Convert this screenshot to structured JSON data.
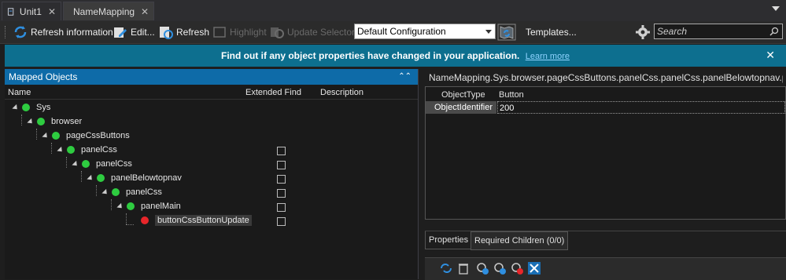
{
  "tabs": [
    {
      "label": "Unit1",
      "icon": "unit-document-icon"
    },
    {
      "label": "NameMapping",
      "icon": "namemapping-icon"
    }
  ],
  "toolbar": {
    "refresh_information": "Refresh information",
    "edit": "Edit...",
    "refresh": "Refresh",
    "highlight": "Highlight",
    "update_selectors": "Update Selectors",
    "configuration": "Default Configuration",
    "templates": "Templates...",
    "search_placeholder": "Search"
  },
  "banner": {
    "message": "Find out if any object properties have changed in your application.",
    "link": "Learn more"
  },
  "left_panel": {
    "title": "Mapped Objects",
    "columns": [
      "Name",
      "Extended Find",
      "Description"
    ],
    "tree": [
      {
        "label": "Sys",
        "status": "green",
        "level": 0
      },
      {
        "label": "browser",
        "status": "green",
        "level": 1
      },
      {
        "label": "pageCssButtons",
        "status": "green",
        "level": 2
      },
      {
        "label": "panelCss",
        "status": "green",
        "level": 3
      },
      {
        "label": "panelCss",
        "status": "green",
        "level": 4
      },
      {
        "label": "panelBelowtopnav",
        "status": "green",
        "level": 5
      },
      {
        "label": "panelCss",
        "status": "green",
        "level": 6
      },
      {
        "label": "panelMain",
        "status": "green",
        "level": 7
      },
      {
        "label": "buttonCssButtonUpdate",
        "status": "red",
        "level": 8
      }
    ]
  },
  "right_panel": {
    "path": "NameMapping.Sys.browser.pageCssButtons.panelCss.panelCss.panelBelowtopnav.panelCss.panelMair",
    "properties": [
      {
        "name": "ObjectType",
        "value": "Button"
      },
      {
        "name": "ObjectIdentifier",
        "value": "200"
      }
    ],
    "tabs": [
      "Properties",
      "Required Children (0/0)"
    ]
  }
}
